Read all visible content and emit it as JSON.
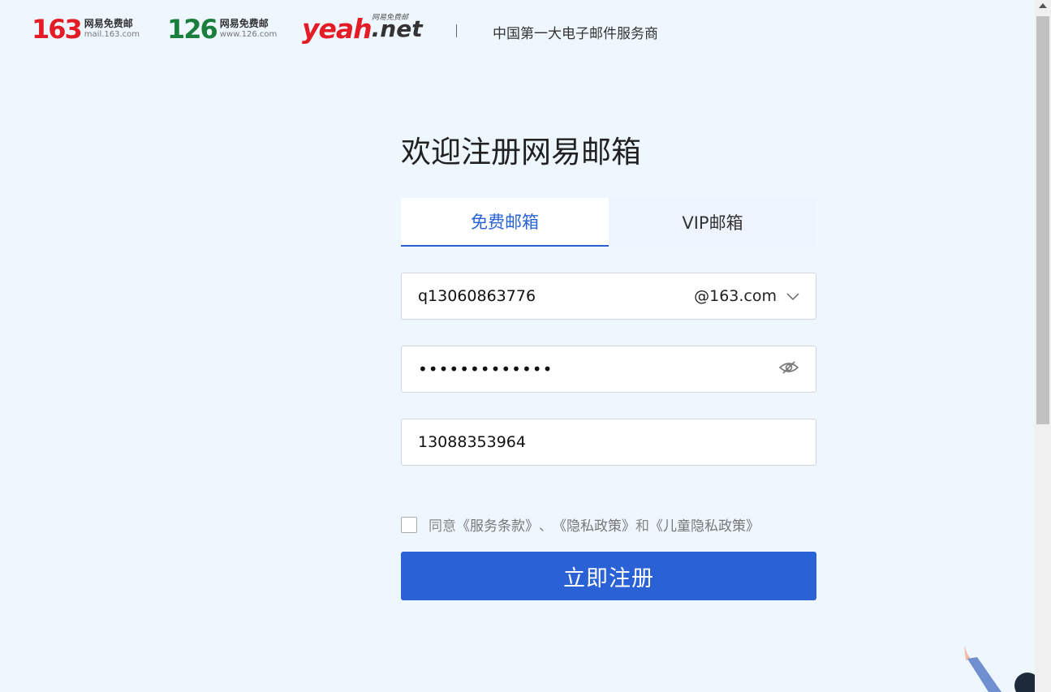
{
  "header": {
    "logo_163": {
      "num": "163",
      "cn": "网易免费邮",
      "en": "mail.163.com"
    },
    "logo_126": {
      "num": "126",
      "cn": "网易免费邮",
      "en": "www.126.com"
    },
    "logo_yeah": {
      "part1": "yeah",
      "part2": ".net",
      "tag": "网易免费邮"
    },
    "slogan": "中国第一大电子邮件服务商"
  },
  "main": {
    "title": "欢迎注册网易邮箱",
    "tabs": [
      {
        "label": "免费邮箱",
        "active": true
      },
      {
        "label": "VIP邮箱",
        "active": false
      }
    ],
    "username": {
      "value": "q13060863776",
      "suffix": "@163.com"
    },
    "password": {
      "masked": "•••••••••••••"
    },
    "phone": {
      "value": "13088353964"
    },
    "agreement": {
      "prefix": "同意",
      "link1": "《服务条款》",
      "sep": "、",
      "link2": "《隐私政策》",
      "and": "和",
      "link3": "《儿童隐私政策》",
      "checked": false
    },
    "submit_label": "立即注册"
  },
  "colors": {
    "accent": "#2a62d6",
    "background": "#eef6fe",
    "brand_red": "#e31c25",
    "brand_green": "#1a7f3c"
  },
  "icons": [
    "chevron-down-icon",
    "eye-slash-icon"
  ]
}
